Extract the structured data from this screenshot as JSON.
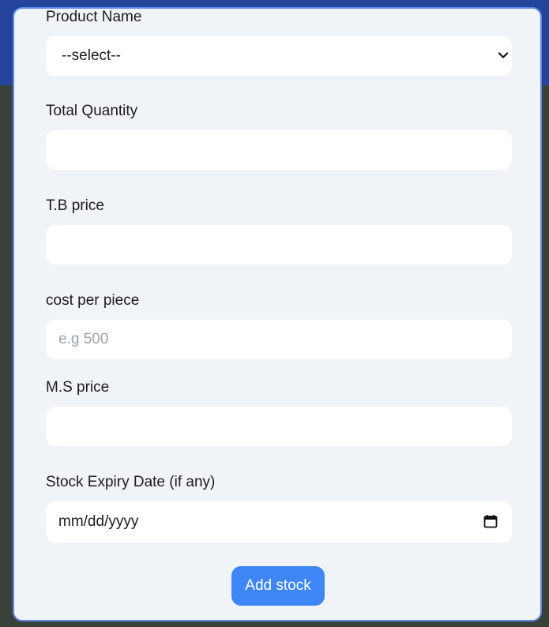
{
  "form": {
    "product_name": {
      "label": "Product Name",
      "selected": "--select--"
    },
    "total_quantity": {
      "label": "Total Quantity",
      "value": ""
    },
    "tb_price": {
      "label": "T.B price",
      "value": ""
    },
    "cost_per_piece": {
      "label": "cost per piece",
      "placeholder": "e.g 500"
    },
    "ms_price": {
      "label": "M.S price",
      "value": ""
    },
    "expiry_date": {
      "label": "Stock Expiry Date (if any)",
      "value": "mm/dd/yyyy"
    },
    "submit_label": "Add stock"
  },
  "icons": {
    "select_chevron": "chevron-down-icon",
    "date_picker": "calendar-icon"
  },
  "colors": {
    "accent": "#3e86f5",
    "modal_bg": "#f0f3f8",
    "header_band": "#24439a"
  }
}
